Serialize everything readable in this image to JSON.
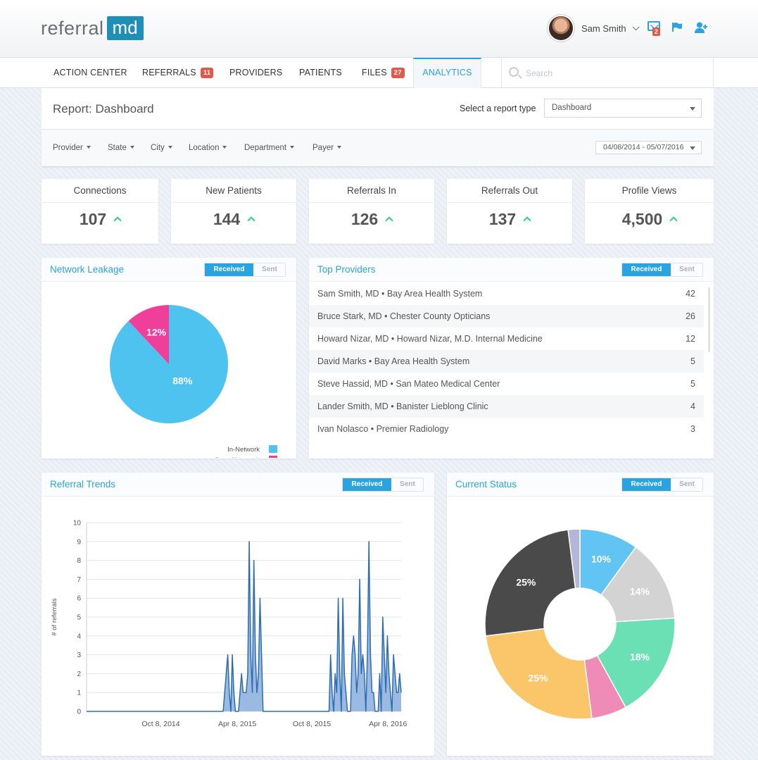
{
  "header": {
    "logo_text": "referral",
    "logo_box_text": "md",
    "user_name": "Sam Smith",
    "mail_badge": "2",
    "icons": [
      "mail-icon",
      "flag-icon",
      "add-user-icon"
    ]
  },
  "nav": {
    "items": [
      {
        "label": "ACTION CENTER"
      },
      {
        "label": "REFERRALS",
        "badge": "11"
      },
      {
        "label": "PROVIDERS"
      },
      {
        "label": "PATIENTS"
      },
      {
        "label": "FILES",
        "badge": "27"
      },
      {
        "label": "ANALYTICS",
        "active": true
      }
    ],
    "search_placeholder": "Search"
  },
  "report": {
    "title": "Report: Dashboard",
    "type_label": "Select a report type",
    "type_value": "Dashboard",
    "filters": [
      "Provider",
      "State",
      "City",
      "Location",
      "Department",
      "Payer"
    ],
    "date_range": "04/08/2014 - 05/07/2016"
  },
  "stats": [
    {
      "label": "Connections",
      "value": "107"
    },
    {
      "label": "New Patients",
      "value": "144"
    },
    {
      "label": "Referrals In",
      "value": "126"
    },
    {
      "label": "Referrals Out",
      "value": "137"
    },
    {
      "label": "Profile Views",
      "value": "4,500"
    }
  ],
  "toggle": {
    "on": "Received",
    "off": "Sent"
  },
  "panels": {
    "network_leakage": "Network Leakage",
    "top_providers": "Top Providers",
    "referral_trends": "Referral Trends",
    "current_status": "Current Status"
  },
  "top_providers": [
    {
      "name": "Sam Smith, MD • Bay Area Health System",
      "count": "42"
    },
    {
      "name": "Bruce Stark, MD • Chester County Opticians",
      "count": "26"
    },
    {
      "name": "Howard Nizar, MD • Howard Nizar, M.D. Internal Medicine",
      "count": "12"
    },
    {
      "name": "David Marks • Bay Area Health System",
      "count": "5"
    },
    {
      "name": "Steve Hassid, MD • San Mateo Medical Center",
      "count": "5"
    },
    {
      "name": "Lander Smith, MD • Banister Lieblong Clinic",
      "count": "4"
    },
    {
      "name": "Ivan Nolasco • Premier Radiology",
      "count": "3"
    }
  ],
  "chart_data": [
    {
      "type": "pie",
      "labels": [
        "In-Network",
        "Out-of-Network"
      ],
      "values": [
        88,
        12
      ],
      "data_labels": [
        "88%",
        "12%"
      ],
      "colors": [
        "#4fc3f0",
        "#ef3f9a"
      ],
      "legend": "bottom-right"
    },
    {
      "type": "area",
      "ylabel": "# of referrals",
      "ylim": [
        0,
        10
      ],
      "yticks": [
        "0",
        "1",
        "2",
        "3",
        "4",
        "5",
        "6",
        "7",
        "8",
        "9",
        "10"
      ],
      "xtick_labels": [
        "Oct 8, 2014",
        "Apr 8, 2015",
        "Oct 8, 2015",
        "Apr 8, 2016"
      ],
      "grid": true,
      "color": "#2f6db0",
      "fill": "#8fb3de",
      "values": [
        0,
        0,
        0,
        0,
        0,
        0,
        0,
        0,
        0,
        0,
        0,
        0,
        0,
        0,
        0,
        0,
        0,
        0,
        0,
        0,
        0,
        0,
        0,
        0,
        0,
        0,
        0,
        0,
        0,
        0,
        0,
        0,
        0,
        0,
        0,
        0,
        0,
        0,
        0,
        0,
        0,
        0,
        0,
        0,
        0,
        0,
        0,
        0,
        0,
        0,
        0,
        0,
        0,
        0,
        0,
        0,
        0,
        0,
        0,
        0,
        0,
        0,
        0,
        0,
        0,
        0,
        0,
        0,
        0,
        0,
        0,
        0,
        0,
        0,
        0,
        0,
        0,
        0,
        0,
        0,
        0,
        0,
        0,
        0,
        0,
        0,
        0,
        0,
        0,
        0,
        1,
        2,
        3,
        1,
        0,
        3,
        1,
        0,
        0,
        0,
        1,
        2,
        1,
        1,
        1,
        2,
        9,
        3,
        1,
        8,
        3,
        1,
        2,
        6,
        3,
        0,
        0,
        0,
        0,
        0,
        0,
        0,
        0,
        0,
        0,
        0,
        0,
        0,
        0,
        0,
        0,
        0,
        0,
        0,
        0,
        0,
        0,
        0,
        0,
        0,
        0,
        0,
        0,
        0,
        0,
        0,
        0,
        0,
        0,
        0,
        0,
        0,
        0,
        0,
        0,
        0,
        0,
        0,
        0,
        3,
        1,
        0,
        2,
        1,
        6,
        2,
        0,
        6,
        2,
        1,
        0,
        0,
        0,
        3,
        4,
        3,
        1,
        2,
        7,
        2,
        3,
        2,
        0,
        3,
        9,
        3,
        1,
        1,
        0,
        0,
        0,
        2,
        0,
        5,
        3,
        1,
        4,
        2,
        1,
        0,
        3,
        2,
        1,
        1,
        2,
        1
      ],
      "x_start": 0,
      "x_end": 1,
      "xtick_positions": [
        0.236,
        0.479,
        0.716,
        0.958
      ]
    },
    {
      "type": "pie",
      "style": "donut",
      "values": [
        10,
        14,
        18,
        6,
        25,
        25,
        2
      ],
      "data_labels": [
        "10%",
        "14%",
        "18%",
        "",
        "25%",
        "25%",
        ""
      ],
      "colors": [
        "#62c4f2",
        "#d3d3d3",
        "#6ae0b4",
        "#f08ab6",
        "#fbc56a",
        "#4a4a4a",
        "#b3b6d6"
      ]
    }
  ]
}
